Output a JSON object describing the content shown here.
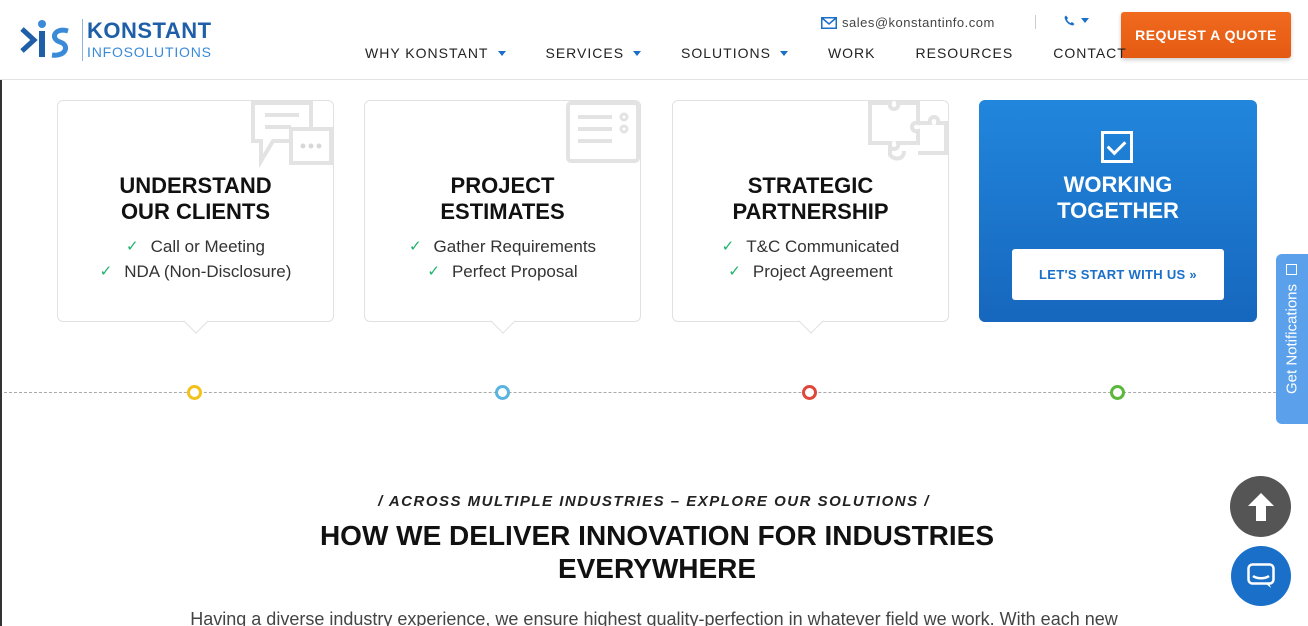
{
  "header": {
    "logo_line1": "KONSTANT",
    "logo_line2": "INFOSOLUTIONS",
    "email": "sales@konstantinfo.com",
    "quote_button": "REQUEST A QUOTE",
    "nav": [
      {
        "label": "WHY KONSTANT",
        "has_dropdown": true
      },
      {
        "label": "SERVICES",
        "has_dropdown": true
      },
      {
        "label": "SOLUTIONS",
        "has_dropdown": true
      },
      {
        "label": "WORK",
        "has_dropdown": false
      },
      {
        "label": "RESOURCES",
        "has_dropdown": false
      },
      {
        "label": "CONTACT",
        "has_dropdown": false
      }
    ],
    "icons": {
      "mail": "envelope-icon",
      "phone": "phone-icon"
    }
  },
  "cards": [
    {
      "title": "UNDERSTAND OUR CLIENTS",
      "items": [
        "Call or Meeting",
        "NDA (Non-Disclosure)"
      ],
      "icon": "chat-bubbles-icon",
      "dot_color": "#f2c21b"
    },
    {
      "title": "PROJECT ESTIMATES",
      "items": [
        "Gather Requirements",
        "Perfect Proposal"
      ],
      "icon": "estimate-form-icon",
      "dot_color": "#5ab4e0"
    },
    {
      "title": "STRATEGIC PARTNERSHIP",
      "items": [
        "T&C Communicated",
        "Project Agreement"
      ],
      "icon": "puzzle-icon",
      "dot_color": "#e0473b"
    }
  ],
  "highlight_card": {
    "title": "WORKING TOGETHER",
    "button": "LET'S START WITH US »",
    "icon": "checkbox-icon",
    "dot_color": "#5cb83c"
  },
  "notifications_tab": "Get Notifications",
  "section": {
    "eyebrow": "/ ACROSS MULTIPLE INDUSTRIES – EXPLORE OUR SOLUTIONS /",
    "title": "HOW WE DELIVER INNOVATION FOR INDUSTRIES EVERYWHERE",
    "description": "Having a diverse industry experience, we ensure highest quality-perfection in whatever field we work. With each new"
  },
  "colors": {
    "brand_blue": "#1a6fc9",
    "accent_orange": "#e55a12",
    "check_green": "#1db36b"
  }
}
